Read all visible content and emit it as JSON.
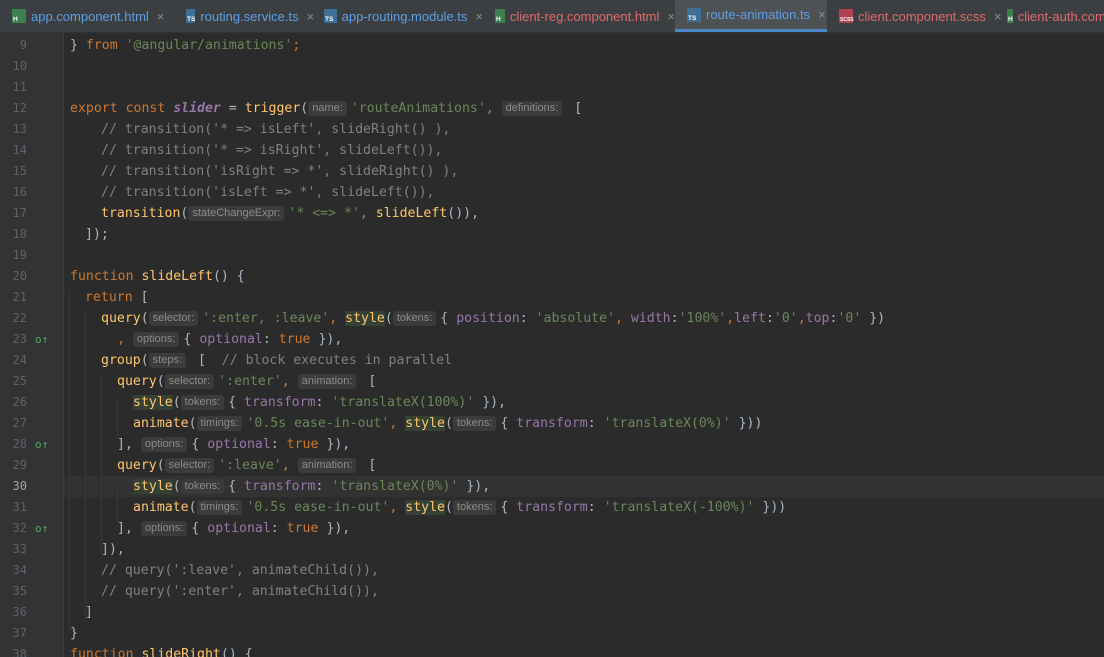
{
  "tabs": [
    {
      "name": "app.component.html",
      "type": "html",
      "color": "#5c9fe8"
    },
    {
      "name": "routing.service.ts",
      "type": "ts",
      "color": "#5c9fe8"
    },
    {
      "name": "app-routing.module.ts",
      "type": "ts",
      "color": "#5c9fe8"
    },
    {
      "name": "client-reg.component.html",
      "type": "html",
      "color": "#e16a6a"
    },
    {
      "name": "route-animation.ts",
      "type": "ts",
      "color": "#5c9fe8",
      "active": true
    },
    {
      "name": "client.component.scss",
      "type": "scss",
      "color": "#e16a6a"
    },
    {
      "name": "client-auth.com",
      "type": "html",
      "color": "#e16a6a"
    }
  ],
  "icons": {
    "html": "H",
    "ts": "TS",
    "scss": "SCSS",
    "close": "×",
    "gutter_mark": "o↑"
  },
  "lines": [
    {
      "num": "9",
      "text": "} from '@angular/animations';"
    },
    {
      "num": "10",
      "text": ""
    },
    {
      "num": "11",
      "text": ""
    },
    {
      "num": "12",
      "text": "export const slider = trigger(name: 'routeAnimations', definitions: ["
    },
    {
      "num": "13",
      "text": "// transition('* => isLeft', slideRight() ),"
    },
    {
      "num": "14",
      "text": "// transition('* => isRight', slideLeft()),"
    },
    {
      "num": "15",
      "text": "// transition('isRight => *', slideRight() ),"
    },
    {
      "num": "16",
      "text": "// transition('isLeft => *', slideLeft()),"
    },
    {
      "num": "17",
      "text": "transition(stateChangeExpr: '* <=> *', slideLeft()),"
    },
    {
      "num": "18",
      "text": "]);"
    },
    {
      "num": "19",
      "text": ""
    },
    {
      "num": "20",
      "text": "function slideLeft() {"
    },
    {
      "num": "21",
      "text": "return ["
    },
    {
      "num": "22",
      "text": "query(selector: ':enter, :leave', style(tokens: { position: 'absolute', width:'100%',left:'0',top:'0' })"
    },
    {
      "num": "23",
      "text": ", options: { optional: true }),"
    },
    {
      "num": "24",
      "text": "group(steps: [  // block executes in parallel"
    },
    {
      "num": "25",
      "text": "query(selector: ':enter', animation: ["
    },
    {
      "num": "26",
      "text": "style(tokens: { transform: 'translateX(100%)' }),"
    },
    {
      "num": "27",
      "text": "animate(timings: '0.5s ease-in-out', style(tokens: { transform: 'translateX(0%)' }))"
    },
    {
      "num": "28",
      "text": "], options: { optional: true }),"
    },
    {
      "num": "29",
      "text": "query(selector: ':leave', animation: ["
    },
    {
      "num": "30",
      "text": "style(tokens: { transform: 'translateX(0%)' }),"
    },
    {
      "num": "31",
      "text": "animate(timings: '0.5s ease-in-out', style(tokens: { transform: 'translateX(-100%)' }))"
    },
    {
      "num": "32",
      "text": "], options: { optional: true }),"
    },
    {
      "num": "33",
      "text": "]),"
    },
    {
      "num": "34",
      "text": "// query(':leave', animateChild()),"
    },
    {
      "num": "35",
      "text": "// query(':enter', animateChild()),"
    },
    {
      "num": "36",
      "text": "]"
    },
    {
      "num": "37",
      "text": "}"
    },
    {
      "num": "38",
      "text": "function slideRight() {"
    }
  ],
  "current_line": "30",
  "code": {
    "l9_a": "} ",
    "l9_from": "from ",
    "l9_str": "'@angular/animations'",
    "l9_end": ";",
    "kw_export": "export ",
    "kw_const": "const ",
    "slider": "slider",
    " eq": " = ",
    "trigger": "trigger",
    "p_open": "(",
    "ph_name": "name:",
    "s_routeAnimations": "'routeAnimations'",
    "comma": ", ",
    "ph_definitions": "definitions:",
    "bracket_open": " [",
    "c13": "// transition('* => isLeft', slideRight() ),",
    "c14": "// transition('* => isRight', slideLeft()),",
    "c15": "// transition('isRight => *', slideRight() ),",
    "c16": "// transition('isLeft => *', slideLeft()),",
    "transition": "transition",
    "ph_stateChangeExpr": "stateChangeExpr:",
    "s_star": "'* <=> *'",
    "slideLeft": "slideLeft",
    "l17_end": "()),",
    "l18": "]);",
    "kw_function": "function ",
    "l20_end": "() {",
    "kw_return": "return ",
    "l21_end": "[",
    "query": "query",
    "ph_selector": "selector:",
    "s_enter_leave": "':enter, :leave'",
    "style": "style",
    "ph_tokens": "tokens:",
    "brace_open": "{ ",
    "position": "position",
    "colon": ": ",
    "s_absolute": "'absolute'",
    "width": "width",
    "s_100": "'100%'",
    "left": "left",
    "s_0": "'0'",
    "top": "top",
    "l22_end": " })",
    "l23_pre": ", ",
    "ph_options": "options:",
    "optional": "optional",
    "kw_true": "true",
    "l23_end": " }),",
    "group": "group",
    "ph_steps": "steps:",
    "l24_mid": " [  ",
    "c24": "// block executes in parallel",
    "s_enter": "':enter'",
    "ph_animation": "animation:",
    "transform": "transform",
    "s_tx100": "'translateX(100%)'",
    "l26_end": " }),",
    "animate": "animate",
    "ph_timings": "timings:",
    "s_ease": "'0.5s ease-in-out'",
    "s_tx0": "'translateX(0%)'",
    "l27_end": " }))",
    "l28_pre": "], ",
    "s_leave": "':leave'",
    "s_txm100": "'translateX(-100%)'",
    "l33": "]),",
    "c34": "// query(':leave', animateChild()),",
    "c35": "// query(':enter', animateChild()),",
    "l36": "]",
    "l37": "}",
    "slideRight": "slideRight"
  }
}
